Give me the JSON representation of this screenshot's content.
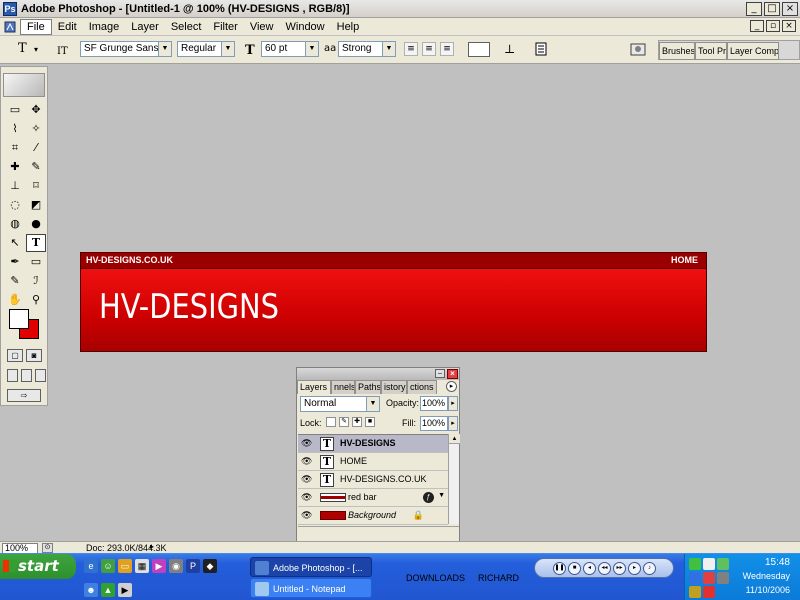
{
  "window": {
    "title": "Adobe Photoshop - [Untitled-1 @ 100% (HV-DESIGNS , RGB/8)]",
    "controls": {
      "minimize": "_",
      "maximize": "□",
      "close": "×"
    }
  },
  "menu": {
    "items": [
      "File",
      "Edit",
      "Image",
      "Layer",
      "Select",
      "Filter",
      "View",
      "Window",
      "Help"
    ],
    "doc_controls": {
      "minimize": "_",
      "restore": "▫",
      "close": "×"
    }
  },
  "options_bar": {
    "tool_glyph": "T",
    "font_family": "SF Grunge Sans ...",
    "font_style": "Regular",
    "font_size": "60 pt",
    "anti_alias": "Strong",
    "anti_alias_glyph": "aa",
    "palette_tabs": [
      "Brushes",
      "Tool Pr",
      "Layer Comps"
    ]
  },
  "toolbox": {
    "tools": [
      "▭",
      "✥",
      "⌇",
      "✧",
      "⌗",
      "⁄",
      "✚",
      "✎",
      "⊥",
      "⌑",
      "◌",
      "◩",
      "◍",
      "●",
      "↖",
      "T",
      "✒",
      "▭",
      "✎",
      "ℐ",
      "✋",
      "⚲"
    ]
  },
  "canvas": {
    "site_name": "HV-DESIGNS.CO.UK",
    "nav_home": "HOME",
    "heading": "HV-DESIGNS"
  },
  "layers_panel": {
    "tabs": [
      "Layers",
      "nnels",
      "Paths",
      "istory",
      "ctions"
    ],
    "blend_mode": "Normal",
    "opacity_label": "Opacity:",
    "opacity_value": "100%",
    "lock_label": "Lock:",
    "fill_label": "Fill:",
    "fill_value": "100%",
    "layers": [
      {
        "name": "HV-DESIGNS",
        "type": "text",
        "selected": true
      },
      {
        "name": "HOME",
        "type": "text",
        "selected": false
      },
      {
        "name": "HV-DESIGNS.CO.UK",
        "type": "text",
        "selected": false
      },
      {
        "name": "red bar",
        "type": "shape",
        "selected": false
      },
      {
        "name": "Background",
        "type": "background",
        "selected": false
      }
    ]
  },
  "status_bar": {
    "zoom": "100%",
    "doc_info": "Doc: 293.0K/844.3K"
  },
  "taskbar": {
    "start_label": "start",
    "tasks": [
      {
        "label": "Adobe Photoshop - [...",
        "active": true
      },
      {
        "label": "Untitled - Notepad",
        "active": false
      }
    ],
    "toolbar_labels": [
      "DOWNLOADS",
      "RICHARD"
    ],
    "clock_time": "15:48",
    "clock_day": "Wednesday",
    "clock_date": "11/10/2006"
  }
}
